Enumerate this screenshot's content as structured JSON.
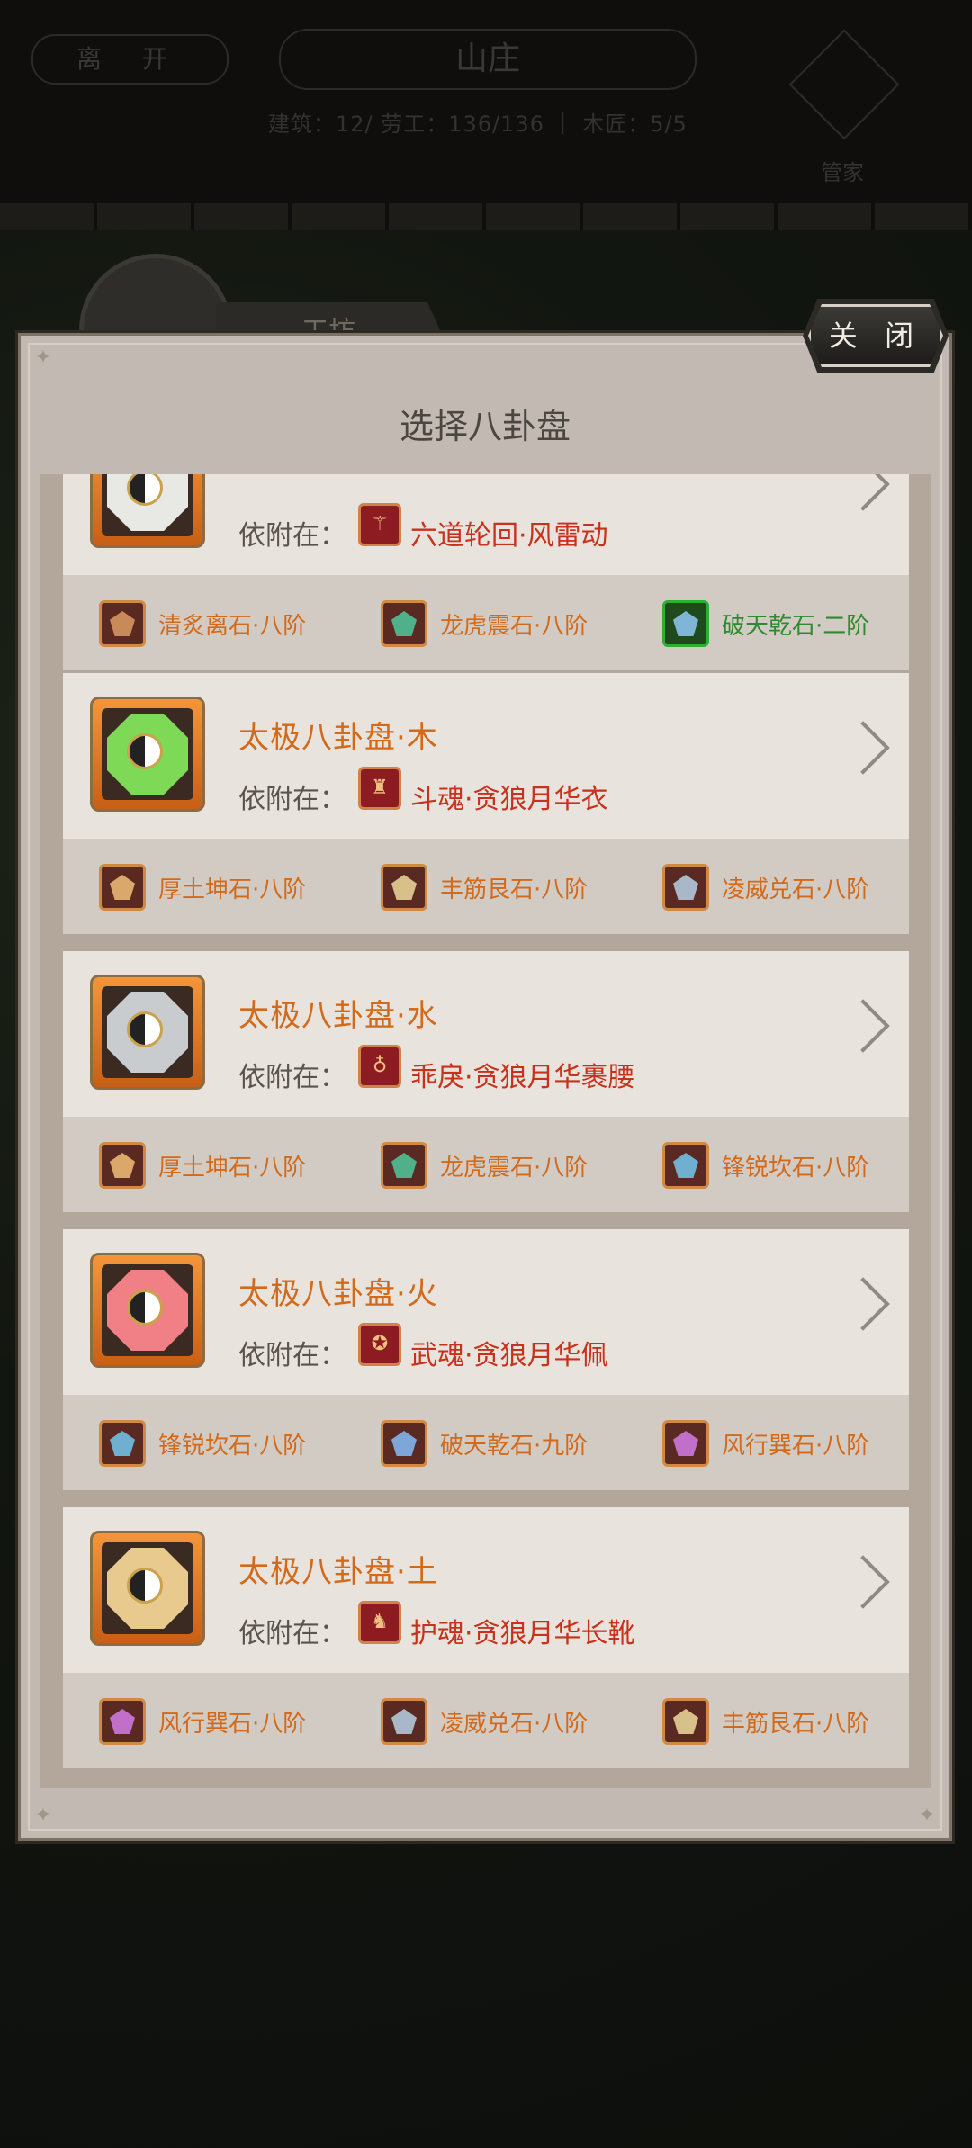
{
  "background": {
    "leave_label": "离 开",
    "title": "山庄",
    "stats": "建筑：12/  劳工：136/136 ｜ 木匠：5/5",
    "steward_label": "管家",
    "workshop_label": "工坊"
  },
  "modal": {
    "title": "选择八卦盘",
    "close_label": "关 闭",
    "attach_label": "依附在："
  },
  "cards": [
    {
      "name": "",
      "disc_color": "#e8e8e4",
      "equip_icon": "staff-icon",
      "equip": "六道轮回·风雷动",
      "stones": [
        {
          "name": "清炙离石·八阶",
          "quality": "orange",
          "gem_color": "#c98a5a"
        },
        {
          "name": "龙虎震石·八阶",
          "quality": "orange",
          "gem_color": "#4fb08a"
        },
        {
          "name": "破天乾石·二阶",
          "quality": "green",
          "gem_color": "#7fb6d8"
        }
      ]
    },
    {
      "name": "太极八卦盘·木",
      "disc_color": "#7ed957",
      "equip_icon": "robe-icon",
      "equip": "斗魂·贪狼月华衣",
      "stones": [
        {
          "name": "厚土坤石·八阶",
          "quality": "orange",
          "gem_color": "#d9a86a"
        },
        {
          "name": "丰筋艮石·八阶",
          "quality": "orange",
          "gem_color": "#d8c08a"
        },
        {
          "name": "凌威兑石·八阶",
          "quality": "orange",
          "gem_color": "#a9b8c8"
        }
      ]
    },
    {
      "name": "太极八卦盘·水",
      "disc_color": "#c8ccce",
      "equip_icon": "belt-icon",
      "equip": "乖戾·贪狼月华裹腰",
      "stones": [
        {
          "name": "厚土坤石·八阶",
          "quality": "orange",
          "gem_color": "#d9a86a"
        },
        {
          "name": "龙虎震石·八阶",
          "quality": "orange",
          "gem_color": "#4fb08a"
        },
        {
          "name": "锋锐坎石·八阶",
          "quality": "orange",
          "gem_color": "#6fb0d0"
        }
      ]
    },
    {
      "name": "太极八卦盘·火",
      "disc_color": "#f07f86",
      "equip_icon": "pendant-icon",
      "equip": "武魂·贪狼月华佩",
      "stones": [
        {
          "name": "锋锐坎石·八阶",
          "quality": "orange",
          "gem_color": "#6fb0d0"
        },
        {
          "name": "破天乾石·九阶",
          "quality": "orange",
          "gem_color": "#7fa6d8"
        },
        {
          "name": "风行巽石·八阶",
          "quality": "orange",
          "gem_color": "#c070c8"
        }
      ]
    },
    {
      "name": "太极八卦盘·土",
      "disc_color": "#e8c98e",
      "equip_icon": "boots-icon",
      "equip": "护魂·贪狼月华长靴",
      "stones": [
        {
          "name": "风行巽石·八阶",
          "quality": "orange",
          "gem_color": "#c070c8"
        },
        {
          "name": "凌威兑石·八阶",
          "quality": "orange",
          "gem_color": "#a9b8c8"
        },
        {
          "name": "丰筋艮石·八阶",
          "quality": "orange",
          "gem_color": "#d8c08a"
        }
      ]
    }
  ]
}
